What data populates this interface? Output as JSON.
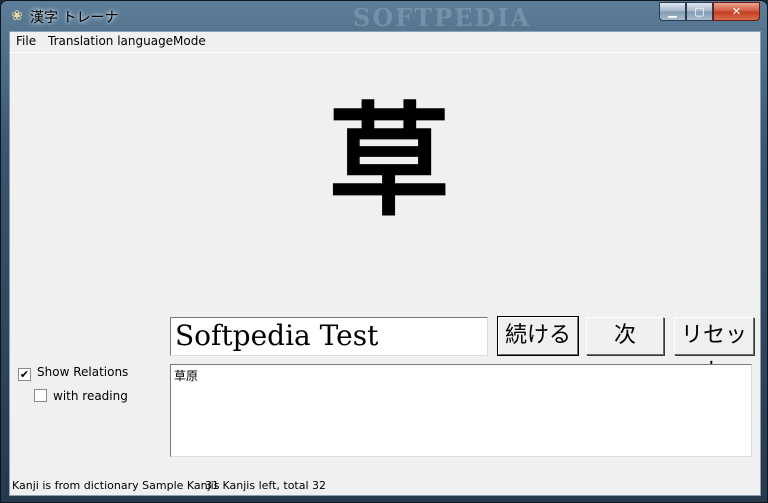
{
  "window": {
    "title": "漢字 トレーナ",
    "watermark": "SOFTPEDIA",
    "controls": {
      "minimize": "▁",
      "maximize": "▢",
      "close": "✕"
    }
  },
  "menu": [
    {
      "label": "File"
    },
    {
      "label": "Translation language"
    },
    {
      "label": "Mode"
    }
  ],
  "kanji": "草",
  "answer": {
    "value": "Softpedia Test"
  },
  "buttons": {
    "continue": "続ける",
    "next": "次",
    "reset": "リセット"
  },
  "options": {
    "show_relations": {
      "label": "Show Relations",
      "checked": true,
      "mark": "✔"
    },
    "with_reading": {
      "label": "with reading",
      "checked": false,
      "mark": ""
    }
  },
  "relations_text": "草原",
  "status": {
    "source": "Kanji is from dictionary Sample Kanjis",
    "counter": "31 Kanjis left, total 32"
  }
}
